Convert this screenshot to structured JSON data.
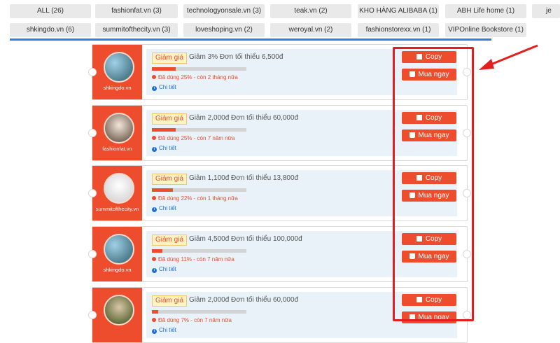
{
  "filters": [
    {
      "label": "ALL (26)"
    },
    {
      "label": "fashionfat.vn (3)"
    },
    {
      "label": "technologyonsale.vn (3)"
    },
    {
      "label": "teak.vn (2)"
    },
    {
      "label": "KHO HÀNG ALIBABA (1)"
    },
    {
      "label": "ABH Life home (1)"
    },
    {
      "label": "je"
    },
    {
      "label": "shkingdo.vn (6)"
    },
    {
      "label": "summitofthecity.vn (3)"
    },
    {
      "label": "loveshoping.vn (2)"
    },
    {
      "label": "weroyal.vn (2)"
    },
    {
      "label": "fashionstorexx.vn (1)"
    },
    {
      "label": "VIPOnline Bookstore (1)"
    }
  ],
  "coupons": [
    {
      "shop": "shkingdo.vn",
      "badge": "Giảm giá",
      "description": "Giảm 3% Đơn tối thiểu 6,500đ",
      "used_percent": 25,
      "used_text": "Đã dùng 25% - còn 2 tháng nữa",
      "detail": "Chi tiết",
      "copy": "Copy",
      "buy": "Mua ngay"
    },
    {
      "shop": "fashionfat.vn",
      "badge": "Giảm giá",
      "description": "Giảm 2,000đ Đơn tối thiểu 60,000đ",
      "used_percent": 25,
      "used_text": "Đã dùng 25% - còn 7 năm nữa",
      "detail": "Chi tiết",
      "copy": "Copy",
      "buy": "Mua ngay"
    },
    {
      "shop": "summitofthecity.vn",
      "badge": "Giảm giá",
      "description": "Giảm 1,100đ Đơn tối thiểu 13,800đ",
      "used_percent": 22,
      "used_text": "Đã dùng 22% - còn 1 tháng nữa",
      "detail": "Chi tiết",
      "copy": "Copy",
      "buy": "Mua ngay"
    },
    {
      "shop": "shkingdo.vn",
      "badge": "Giảm giá",
      "description": "Giảm 4,500đ Đơn tối thiểu 100,000đ",
      "used_percent": 11,
      "used_text": "Đã dùng 11% - còn 7 năm nữa",
      "detail": "Chi tiết",
      "copy": "Copy",
      "buy": "Mua ngay"
    },
    {
      "shop": "",
      "badge": "Giảm giá",
      "description": "Giảm 2,000đ Đơn tối thiểu 60,000đ",
      "used_percent": 7,
      "used_text": "Đã dùng 7% - còn 7 năm nữa",
      "detail": "Chi tiết",
      "copy": "Copy",
      "buy": "Mua ngay"
    }
  ],
  "colors": {
    "brand": "#ee4d2d",
    "tab_underline": "#2f7fdc",
    "annotation": "#e41e1e"
  },
  "icons": {
    "copy": "copy-icon",
    "buy": "cart-icon",
    "used": "clock-icon",
    "detail": "info-icon"
  }
}
